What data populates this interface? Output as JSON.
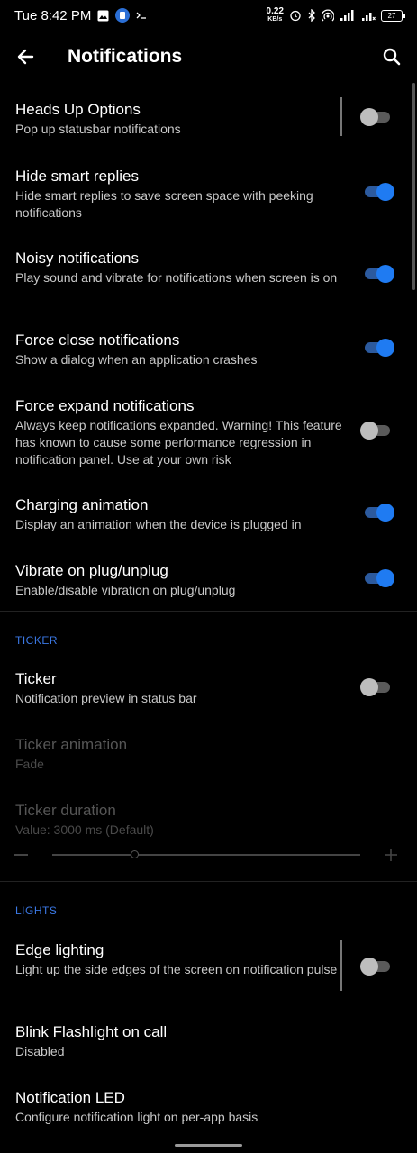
{
  "status_bar": {
    "time": "Tue 8:42 PM",
    "net_speed_value": "0.22",
    "net_speed_unit": "KB/s",
    "battery": "27"
  },
  "app_bar": {
    "title": "Notifications"
  },
  "items": [
    {
      "title": "Heads Up Options",
      "summary": "Pop up statusbar notifications",
      "toggle": "off"
    },
    {
      "title": "Hide smart replies",
      "summary": "Hide smart replies to save screen space with peeking notifications",
      "toggle": "on"
    },
    {
      "title": "Noisy notifications",
      "summary": "Play sound and vibrate for notifications when screen is on",
      "toggle": "on"
    },
    {
      "title": "Force close notifications",
      "summary": "Show a dialog when an application crashes",
      "toggle": "on"
    },
    {
      "title": "Force expand notifications",
      "summary": "Always keep notifications expanded. Warning! This feature has known to cause some performance regression in notification panel. Use at your own risk",
      "toggle": "off"
    },
    {
      "title": "Charging animation",
      "summary": "Display an animation when the device is plugged in",
      "toggle": "on"
    },
    {
      "title": "Vibrate on plug/unplug",
      "summary": "Enable/disable vibration on plug/unplug",
      "toggle": "on"
    }
  ],
  "ticker_section": {
    "header": "TICKER",
    "ticker": {
      "title": "Ticker",
      "summary": "Notification preview in status bar",
      "toggle": "off"
    },
    "ticker_animation": {
      "title": "Ticker animation",
      "summary": "Fade"
    },
    "ticker_duration": {
      "title": "Ticker duration",
      "summary": "Value: 3000 ms (Default)"
    }
  },
  "lights_section": {
    "header": "LIGHTS",
    "edge_lighting": {
      "title": "Edge lighting",
      "summary": "Light up the side edges of the screen on notification pulse",
      "toggle": "off"
    },
    "blink_flashlight": {
      "title": "Blink Flashlight on call",
      "summary": "Disabled"
    },
    "notification_led": {
      "title": "Notification LED",
      "summary": "Configure notification light on per-app basis"
    }
  },
  "colors": {
    "accent": "#1f7bf2",
    "section_header": "#3b79e6",
    "background": "#000000"
  }
}
